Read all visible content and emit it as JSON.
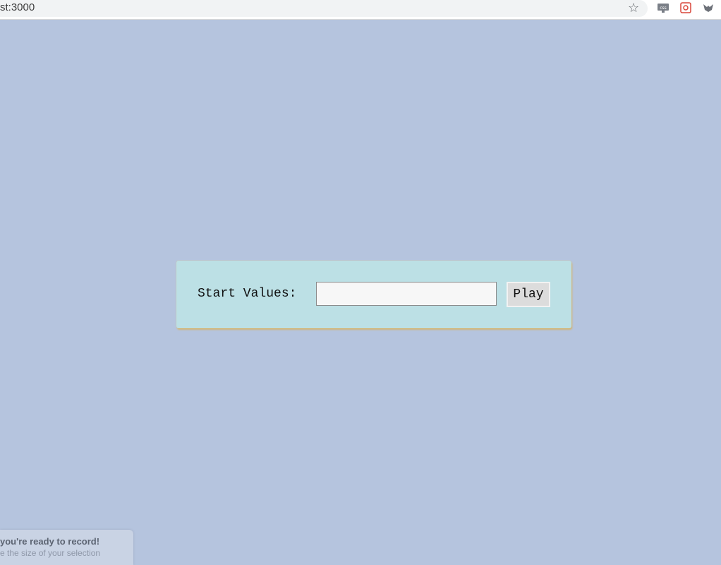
{
  "browser": {
    "url": "st:3000",
    "icons": [
      "star-icon",
      "css-extension-icon",
      "red-extension-icon",
      "fox-extension-icon"
    ]
  },
  "form": {
    "label": "Start Values:",
    "input_value": "",
    "button_label": "Play"
  },
  "toast": {
    "title": "you're ready to record!",
    "subtitle": "e the size of your selection"
  },
  "colors": {
    "background": "#b5c4de",
    "panel": "#bce0e5",
    "panel_shadow": "#d6b36a"
  }
}
